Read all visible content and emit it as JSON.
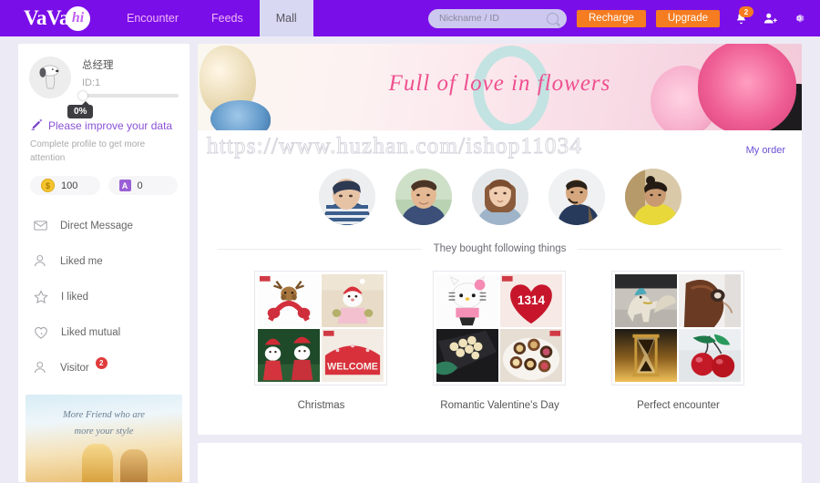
{
  "header": {
    "logo_text": "VaVa",
    "logo_badge": "hi",
    "nav": [
      {
        "label": "Encounter",
        "active": false
      },
      {
        "label": "Feeds",
        "active": false
      },
      {
        "label": "Mall",
        "active": true
      }
    ],
    "search_placeholder": "Nickname / ID",
    "search_value": "",
    "recharge_label": "Recharge",
    "upgrade_label": "Upgrade",
    "notification_count": "2"
  },
  "sidebar": {
    "profile": {
      "name": "总经理",
      "id": "ID:1",
      "progress_label": "0%",
      "progress_percent": 0
    },
    "improve_link": "Please improve your data",
    "improve_subtext": "Complete profile to get more attention",
    "coins": [
      {
        "icon": "coin-icon",
        "value": "100"
      },
      {
        "icon": "a-icon",
        "value": "0"
      }
    ],
    "menu": [
      {
        "label": "Direct Message",
        "icon": "envelope-icon",
        "badge": ""
      },
      {
        "label": "Liked me",
        "icon": "person-icon",
        "badge": ""
      },
      {
        "label": "I liked",
        "icon": "star-icon",
        "badge": ""
      },
      {
        "label": "Liked mutual",
        "icon": "heart-icon",
        "badge": ""
      },
      {
        "label": "Visitor",
        "icon": "person-icon",
        "badge": "2"
      }
    ],
    "banner_text_line1": "More Friend who are",
    "banner_text_line2": "more your style"
  },
  "main": {
    "hero_title": "Full of love in flowers",
    "watermark": "https://www.huzhan.com/ishop11034",
    "my_order_label": "My order",
    "avatars_count": 5,
    "section_title": "They bought following things",
    "products": [
      {
        "caption": "Christmas"
      },
      {
        "caption": "Romantic Valentine's Day"
      },
      {
        "caption": "Perfect encounter"
      }
    ]
  },
  "colors": {
    "brand_purple": "#7a0ee8",
    "accent_orange": "#f57c20",
    "link_purple": "#8a52d6",
    "badge_red": "#e03b3b",
    "hero_pink": "#ef4f8f"
  }
}
